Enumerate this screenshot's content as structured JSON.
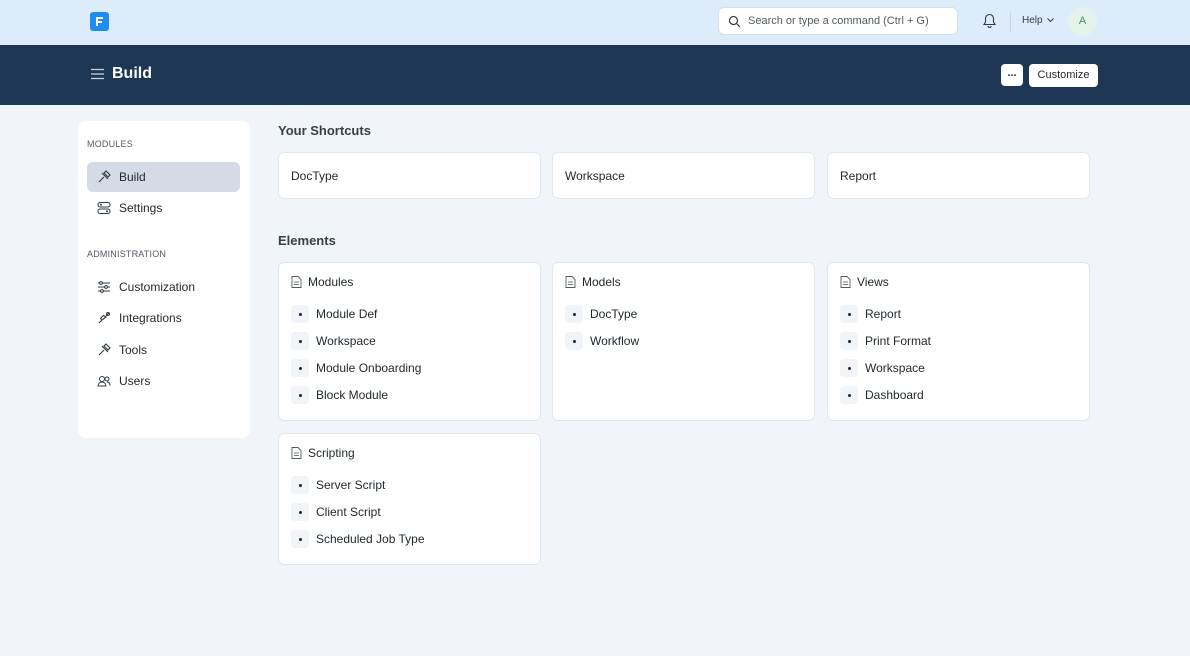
{
  "navbar": {
    "search_placeholder": "Search or type a command (Ctrl + G)",
    "help_label": "Help",
    "avatar_initial": "A"
  },
  "page": {
    "title": "Build",
    "more_label": "...",
    "customize_label": "Customize"
  },
  "sidebar": {
    "modules_heading": "MODULES",
    "modules": [
      {
        "label": "Build",
        "icon": "tools-icon",
        "active": true
      },
      {
        "label": "Settings",
        "icon": "settings-icon",
        "active": false
      }
    ],
    "admin_heading": "ADMINISTRATION",
    "admin": [
      {
        "label": "Customization",
        "icon": "sliders-icon"
      },
      {
        "label": "Integrations",
        "icon": "integration-icon"
      },
      {
        "label": "Tools",
        "icon": "tools-icon"
      },
      {
        "label": "Users",
        "icon": "users-icon"
      }
    ]
  },
  "shortcuts": {
    "heading": "Your Shortcuts",
    "items": [
      "DocType",
      "Workspace",
      "Report"
    ]
  },
  "elements": {
    "heading": "Elements",
    "cards": [
      {
        "title": "Modules",
        "links": [
          "Module Def",
          "Workspace",
          "Module Onboarding",
          "Block Module"
        ]
      },
      {
        "title": "Models",
        "links": [
          "DocType",
          "Workflow"
        ]
      },
      {
        "title": "Views",
        "links": [
          "Report",
          "Print Format",
          "Workspace",
          "Dashboard"
        ]
      },
      {
        "title": "Scripting",
        "links": [
          "Server Script",
          "Client Script",
          "Scheduled Job Type"
        ]
      }
    ]
  },
  "colors": {
    "navbar_bg": "#dcecfb",
    "pagehead_bg": "#1d3654",
    "logo": "#1f8cf0",
    "page_bg": "#f1f4f8"
  }
}
